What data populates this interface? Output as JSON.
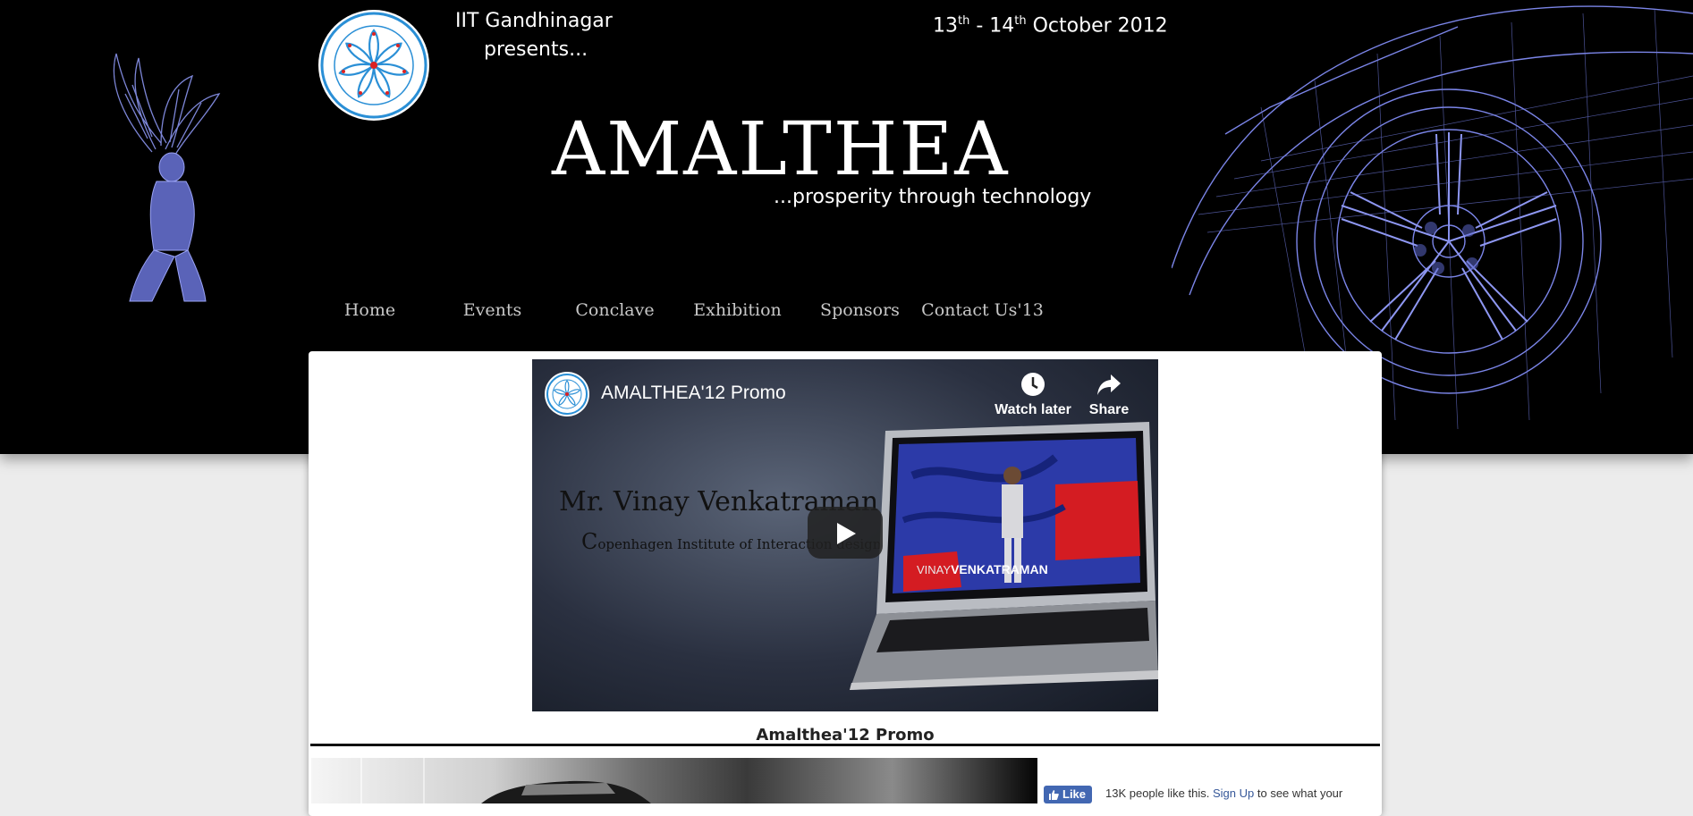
{
  "header": {
    "presenter": "IIT Gandhinagar",
    "presents": "presents...",
    "dates": {
      "start_day": "13",
      "start_suffix": "th",
      "separator": " - ",
      "end_day": "14",
      "end_suffix": "th",
      "month_year": " October 2012"
    },
    "title": "AMALTHEA",
    "tagline": "...prosperity through technology"
  },
  "nav": {
    "items": [
      {
        "label": "Home"
      },
      {
        "label": "Events"
      },
      {
        "label": "Conclave"
      },
      {
        "label": "Exhibition"
      },
      {
        "label": "Sponsors"
      },
      {
        "label": "Contact Us'13"
      }
    ]
  },
  "video": {
    "title": "AMALTHEA'12 Promo",
    "watch_later_label": "Watch later",
    "share_label": "Share",
    "speaker_name": "Mr. Vinay Venkatraman",
    "speaker_org_initial": "C",
    "speaker_org_rest": "openhagen Institute of Interaction design",
    "laptop_caption_first": "VINAY",
    "laptop_caption_last": "VENKATRAMAN"
  },
  "caption": "Amalthea'12 Promo",
  "facebook": {
    "like_label": "Like",
    "count_text": "13K people like this.",
    "signup_label": "Sign Up",
    "suffix_text": "to see what your"
  },
  "colors": {
    "header_bg": "#000000",
    "page_bg": "#ececec",
    "wireframe_blue": "#7b85e8",
    "facebook_blue": "#4267b2",
    "logo_blue": "#2a8fd6"
  },
  "icons": {
    "logo": "iit-gandhinagar-emblem",
    "watch_later": "clock-icon",
    "share": "share-arrow-icon",
    "play": "play-icon",
    "like": "thumbs-up-icon"
  }
}
